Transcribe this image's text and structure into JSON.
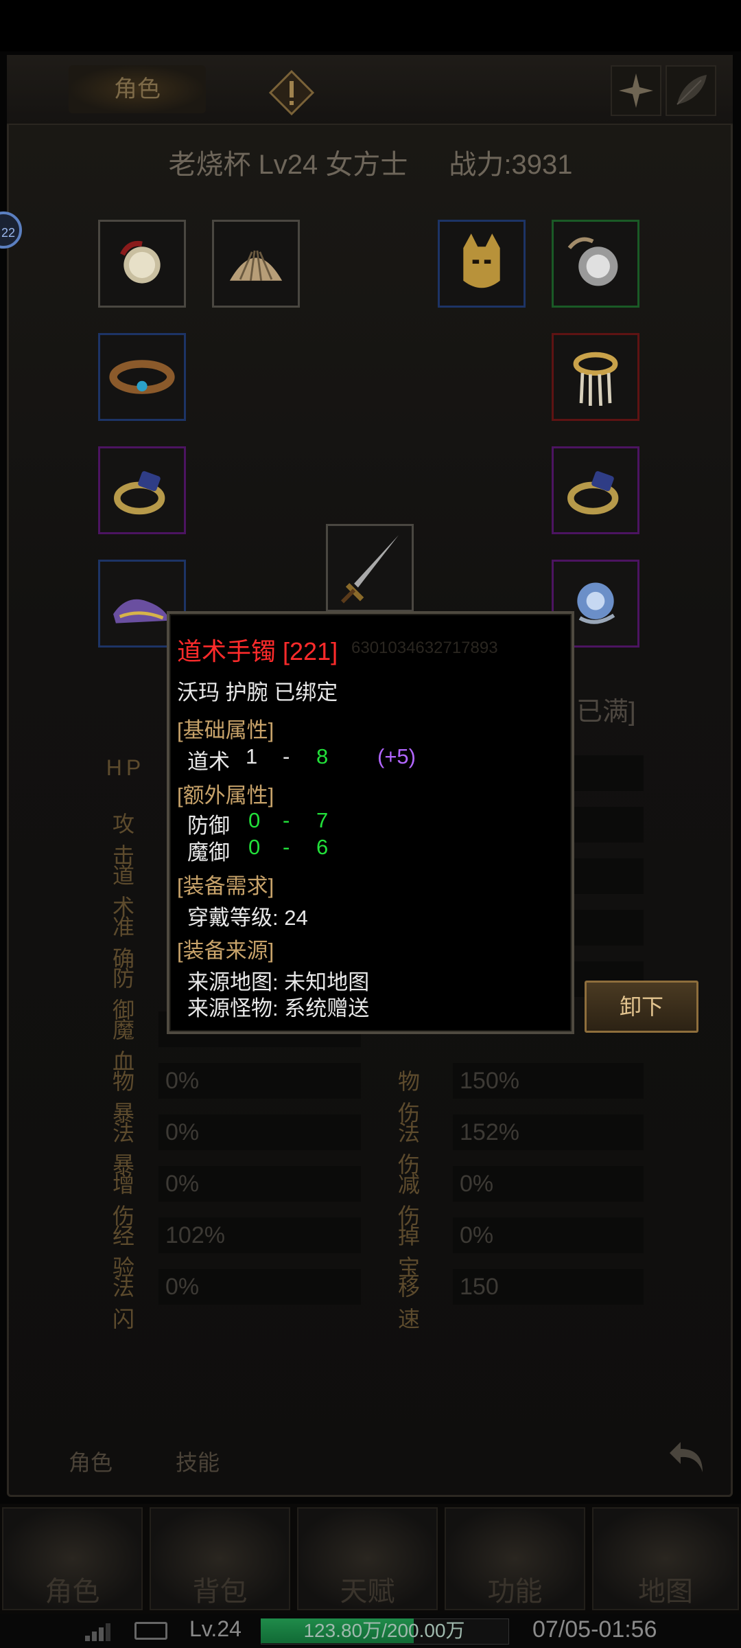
{
  "window": {
    "tab_role": "角色",
    "heading_name": "老烧杯 Lv24 女方士",
    "heading_power": "战力:3931",
    "side_badge": "22"
  },
  "equipment_slots": [
    {
      "name": "necklace",
      "rarity": "plain"
    },
    {
      "name": "cape",
      "rarity": "plain"
    },
    {
      "name": "helmet",
      "rarity": "blue"
    },
    {
      "name": "amulet",
      "rarity": "green"
    },
    {
      "name": "bracelet-left",
      "rarity": "blue"
    },
    {
      "name": "bracelet-right",
      "rarity": "red"
    },
    {
      "name": "ring-left",
      "rarity": "purple"
    },
    {
      "name": "ring-right",
      "rarity": "purple"
    },
    {
      "name": "weapon",
      "rarity": "plain"
    },
    {
      "name": "boots",
      "rarity": "blue"
    },
    {
      "name": "gem",
      "rarity": "purple"
    }
  ],
  "background_fragment": "已满]",
  "stats_left": [
    {
      "label": "HP",
      "value": ""
    },
    {
      "label": "攻击",
      "value": ""
    },
    {
      "label": "道术",
      "value": ""
    },
    {
      "label": "准确",
      "value": ""
    },
    {
      "label": "防御",
      "value": ""
    },
    {
      "label": "魔血",
      "value": ""
    },
    {
      "label": "物暴",
      "value": "0%"
    },
    {
      "label": "法暴",
      "value": "0%"
    },
    {
      "label": "增伤",
      "value": "0%"
    },
    {
      "label": "经验",
      "value": "102%"
    },
    {
      "label": "法闪",
      "value": "0%"
    }
  ],
  "stats_right": [
    {
      "label": "物伤",
      "value": "150%"
    },
    {
      "label": "法伤",
      "value": "152%"
    },
    {
      "label": "减伤",
      "value": "0%"
    },
    {
      "label": "掉宝",
      "value": "0%"
    },
    {
      "label": "移速",
      "value": "150"
    }
  ],
  "tooltip": {
    "item_name": "道术手镯",
    "item_level": "[221]",
    "item_serial": "6301034632717893",
    "subtitle": "沃玛 护腕 已绑定",
    "section_base": "[基础属性]",
    "base_attr_name": "道术",
    "base_attr_min": "1",
    "base_attr_dash": "-",
    "base_attr_max": "8",
    "base_attr_bonus": "(+5)",
    "section_extra": "[额外属性]",
    "extra_attrs": [
      {
        "name": "防御",
        "min": "0",
        "dash": "-",
        "max": "7"
      },
      {
        "name": "魔御",
        "min": "0",
        "dash": "-",
        "max": "6"
      }
    ],
    "section_req": "[装备需求]",
    "req_text": "穿戴等级: 24",
    "section_source": "[装备来源]",
    "source_map": "来源地图:  未知地图",
    "source_monster": "来源怪物:  系统赠送"
  },
  "unequip_button": "卸下",
  "subtabs": {
    "role": "角色",
    "skill": "技能"
  },
  "bottom_nav": [
    {
      "label": "角色"
    },
    {
      "label": "背包"
    },
    {
      "label": "天赋"
    },
    {
      "label": "功能"
    },
    {
      "label": "地图"
    }
  ],
  "status_bar": {
    "level": "Lv.24",
    "exp_text": "123.80万/200.00万",
    "exp_fraction": 0.619,
    "datetime": "07/05-01:56"
  },
  "colors": {
    "item_name": "#ff2b2b",
    "value_green": "#22e03a",
    "bonus_purple": "#b266ff",
    "section_gold": "#c8a36a"
  }
}
